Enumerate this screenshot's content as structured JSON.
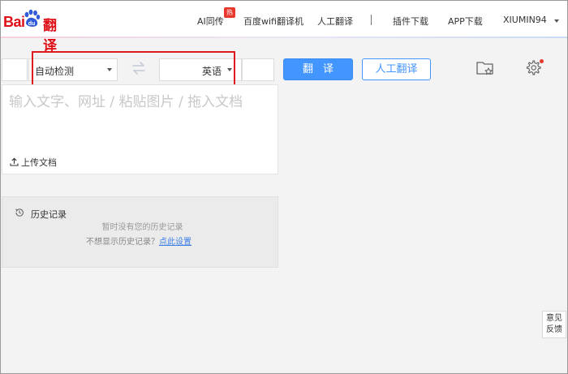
{
  "logo": {
    "text_bai": "Bai",
    "text_fanyi": "翻译"
  },
  "nav": {
    "ai_label": "AI同传",
    "hot_badge": "热",
    "wifi_label": "百度wifi翻译机",
    "human_label": "人工翻译",
    "plugin_label": "插件下载",
    "app_label": "APP下载",
    "user_label": "XIUMIN94"
  },
  "lang_bar": {
    "source_lang": "自动检测",
    "target_lang": "英语",
    "translate_button": "翻译",
    "human_button": "人工翻译"
  },
  "input": {
    "placeholder": "输入文字、网址 / 粘贴图片 / 拖入文档",
    "upload_label": "上传文档"
  },
  "history": {
    "title": "历史记录",
    "empty_text": "暂时没有您的历史记录",
    "hide_prefix": "不想显示历史记录？",
    "hide_link": "点此设置"
  },
  "feedback": {
    "line1": "意见",
    "line2": "反馈"
  },
  "colors": {
    "brand_red": "#de0f17",
    "accent_blue": "#4395ff",
    "highlight_red": "#e0191f"
  }
}
